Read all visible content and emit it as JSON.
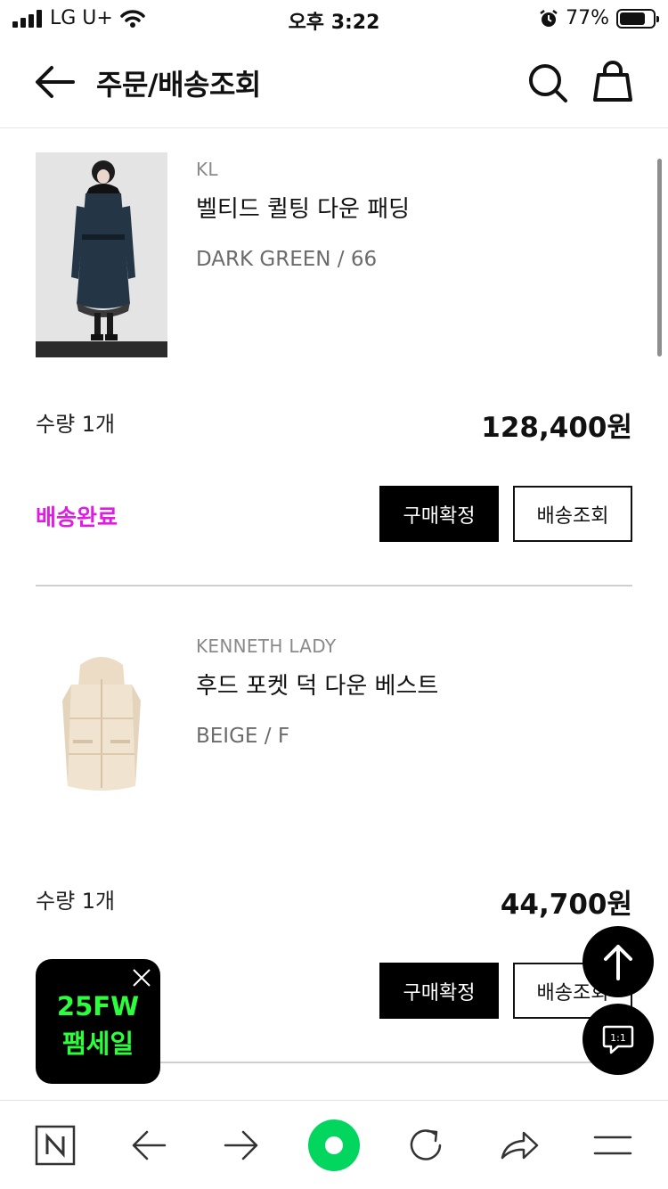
{
  "status_bar": {
    "carrier": "LG U+",
    "time": "오후 3:22",
    "battery": "77%",
    "battery_level": 0.77
  },
  "header": {
    "title": "주문/배송조회",
    "back_icon": "arrow-left-icon",
    "search_icon": "search-icon",
    "bag_icon": "shopping-bag-icon"
  },
  "orders": [
    {
      "brand": "KL",
      "name": "벨티드 퀼팅 다운 패딩",
      "option": "DARK GREEN / 66",
      "quantity": "수량 1개",
      "price": "128,400원",
      "status": "배송완료",
      "status_color": "#e01ce3",
      "confirm_label": "구매확정",
      "track_label": "배송조회"
    },
    {
      "brand": "KENNETH LADY",
      "name": "후드 포켓 덕 다운 베스트",
      "option": "BEIGE / F",
      "quantity": "수량 1개",
      "price": "44,700원",
      "status": "",
      "status_color": "#e01ce3",
      "confirm_label": "구매확정",
      "track_label": "배송조회"
    }
  ],
  "promo": {
    "line1": "25FW",
    "line2": "팸세일",
    "accent": "#2bff3c"
  },
  "floating": {
    "top_icon": "arrow-up-icon",
    "chat_icon": "chat-1on1-icon",
    "chat_label": "1:1"
  },
  "bottom_bar": {
    "items": [
      "naver-icon",
      "back-arrow-icon",
      "forward-arrow-icon",
      "home-circle-icon",
      "refresh-icon",
      "share-icon",
      "menu-icon"
    ],
    "home_color": "#03d65e"
  }
}
